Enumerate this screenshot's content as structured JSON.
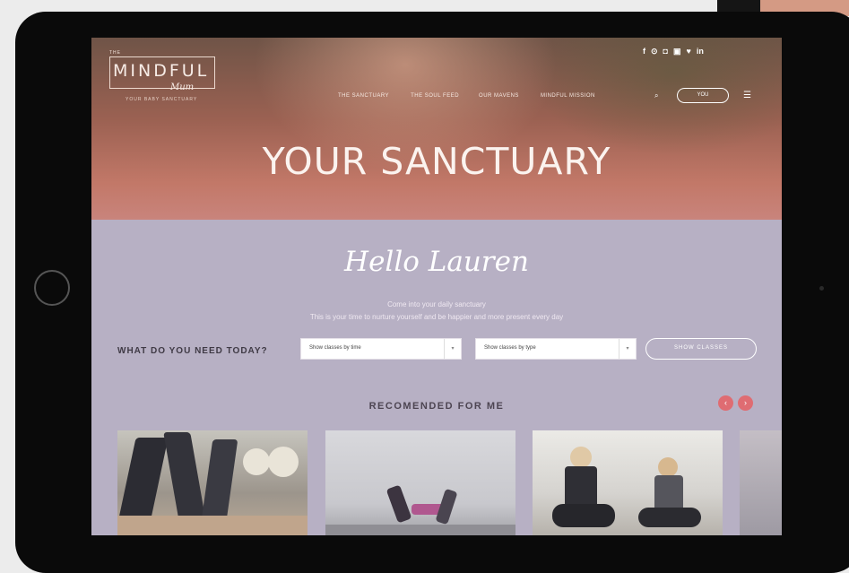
{
  "site": {
    "logo_small": "THE",
    "logo_main": "MINDFUL",
    "logo_script": "Mum",
    "logo_tagline": "YOUR BABY SANCTUARY"
  },
  "social_icons": [
    "facebook-icon",
    "pinterest-icon",
    "instagram-icon",
    "youtube-icon",
    "twitter-icon",
    "linkedin-icon"
  ],
  "social_glyphs": [
    "f",
    "⊙",
    "◘",
    "▣",
    "♥",
    "in"
  ],
  "nav": {
    "items": [
      "THE SANCTUARY",
      "THE SOUL FEED",
      "OUR MAVENS",
      "MINDFUL MISSION"
    ],
    "search_glyph": "⌕",
    "you_label": "YOU",
    "menu_glyph": "☰"
  },
  "hero": {
    "title": "YOUR SANCTUARY"
  },
  "greeting": {
    "title": "Hello Lauren",
    "line1": "Come into your daily sanctuary",
    "line2": "This is your time to nurture yourself and be happier and more present every day"
  },
  "filters": {
    "label": "WHAT DO YOU NEED TODAY?",
    "time_value": "Show classes by time",
    "type_value": "Show classes by type",
    "show_button": "SHOW CLASSES"
  },
  "recommended": {
    "title": "RECOMENDED FOR ME",
    "prev_glyph": "‹",
    "next_glyph": "›"
  },
  "colors": {
    "accent": "#df6c72",
    "hero_tint": "#c27868",
    "panel": "#b7b0c4"
  }
}
